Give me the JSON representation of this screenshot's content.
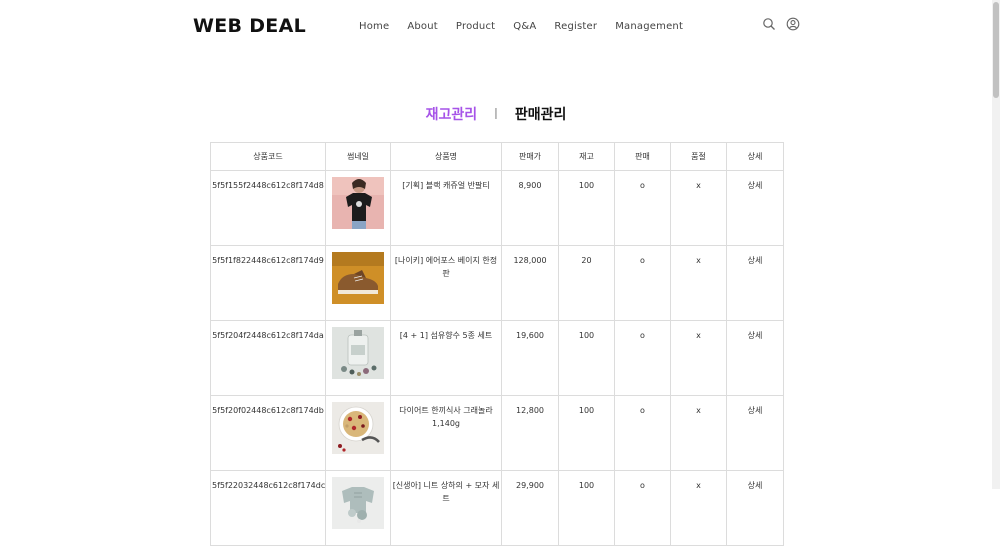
{
  "header": {
    "logo": "WEB DEAL",
    "nav": [
      "Home",
      "About",
      "Product",
      "Q&A",
      "Register",
      "Management"
    ],
    "icons": [
      "search-icon",
      "user-icon"
    ]
  },
  "tabs": {
    "stock": "재고관리",
    "separator": "l",
    "sales": "판매관리",
    "active_color": "#a653e8"
  },
  "table": {
    "headers": [
      "상품코드",
      "썸네일",
      "상품명",
      "판매가",
      "재고",
      "판매",
      "품절",
      "상세"
    ],
    "rows": [
      {
        "code": "5f5f155f2448c612c8f174d8",
        "name": "[기획] 블랙 캐쥬얼 반팔티",
        "price": "8,900",
        "stock": "100",
        "sale": "o",
        "soldout": "x",
        "detail": "상세",
        "thumb": "photo-black-tshirt"
      },
      {
        "code": "5f5f1f822448c612c8f174d9",
        "name": "[나이키] 에어포스 베이지 한정판",
        "price": "128,000",
        "stock": "20",
        "sale": "o",
        "soldout": "x",
        "detail": "상세",
        "thumb": "photo-beige-sneakers"
      },
      {
        "code": "5f5f204f2448c612c8f174da",
        "name": "[4 + 1] 섬유향수 5종 세트",
        "price": "19,600",
        "stock": "100",
        "sale": "o",
        "soldout": "x",
        "detail": "상세",
        "thumb": "photo-fabric-perfume"
      },
      {
        "code": "5f5f20f02448c612c8f174db",
        "name": "다이어트 한끼식사 그래놀라 1,140g",
        "price": "12,800",
        "stock": "100",
        "sale": "o",
        "soldout": "x",
        "detail": "상세",
        "thumb": "photo-granola-bowl"
      },
      {
        "code": "5f5f22032448c612c8f174dc",
        "name": "[신생아] 니트 상하의 + 모자 세트",
        "price": "29,900",
        "stock": "100",
        "sale": "o",
        "soldout": "x",
        "detail": "상세",
        "thumb": "photo-knit-baby-set"
      }
    ]
  }
}
